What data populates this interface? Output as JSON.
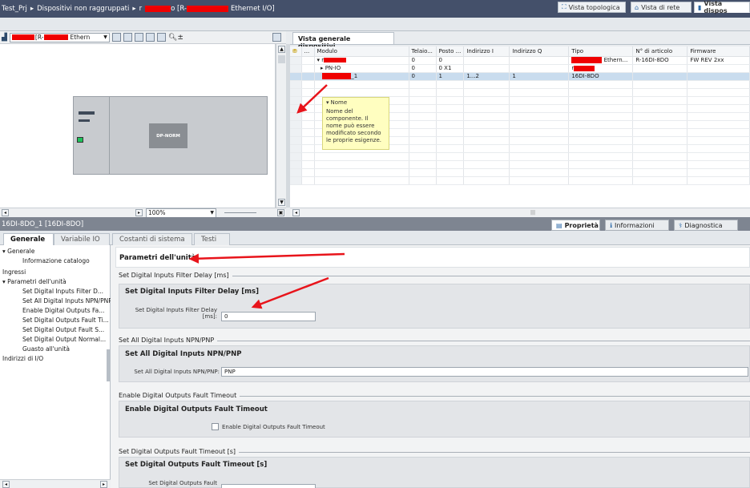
{
  "titlebar": {
    "project": "Test_Prj",
    "folder": "Dispositivi non raggruppati",
    "device_prefix": "r",
    "device_mid": "o [R-",
    "device_suffix": "Ethernet I/O]"
  },
  "view_tabs": {
    "topology": "Vista topologica",
    "network": "Vista di rete",
    "devices": "Vista dispos"
  },
  "toolbar": {
    "device_combo_mid": "[R-",
    "device_combo_suffix": "Ethern",
    "zoom": "100%"
  },
  "canvas": {
    "module_label": "DP-NORM"
  },
  "overview": {
    "tab_label": "Vista generale dispositivi",
    "columns": [
      "Modulo",
      "Telaio...",
      "Posto ...",
      "Indirizzo I",
      "Indirizzo Q",
      "Tipo",
      "N° di articolo",
      "Firmware"
    ],
    "rows": [
      {
        "module": "r",
        "rack": "0",
        "slot": "0",
        "addr_i": "",
        "addr_q": "",
        "type_suffix": "Ethern...",
        "article": "R-16DI-8DO",
        "firmware": "FW REV 2xx"
      },
      {
        "module": "PN-IO",
        "rack": "0",
        "slot": "0 X1",
        "addr_i": "",
        "addr_q": "",
        "type_suffix": "r",
        "article": "",
        "firmware": ""
      },
      {
        "module": "_1",
        "rack": "0",
        "slot": "1",
        "addr_i": "1...2",
        "addr_q": "1",
        "type_suffix": "16DI-8DO",
        "article": "",
        "firmware": ""
      }
    ]
  },
  "tooltip": {
    "title": "Nome",
    "text": "Nome del componente. Il nome può essere modificato secondo le proprie esigenze."
  },
  "inspector": {
    "title": "16DI-8DO_1 [16DI-8DO]",
    "tabs": {
      "properties": "Proprietà",
      "info": "Informazioni",
      "diagnostics": "Diagnostica"
    },
    "subtabs": [
      "Generale",
      "Variabile IO",
      "Costanti di sistema",
      "Testi"
    ]
  },
  "nav": {
    "items": [
      "Generale",
      "Informazione catalogo",
      "Ingressi",
      "Parametri dell'unità",
      "Set Digital Inputs Filter D...",
      "Set All Digital Inputs NPN/PNP",
      "Enable Digital Outputs Fa...",
      "Set Digital Outputs Fault Ti...",
      "Set Digital Output Fault S...",
      "Set Digital Output Normal...",
      "Guasto all'unità",
      "Indirizzi di I/O"
    ]
  },
  "content": {
    "page_title": "Parametri dell'unità",
    "sections": [
      {
        "header": "Set Digital Inputs Filter Delay [ms]",
        "title": "Set Digital Inputs Filter Delay [ms]",
        "label": "Set Digital Inputs Filter Delay [ms]:",
        "value": "0"
      },
      {
        "header": "Set All Digital Inputs NPN/PNP",
        "title": "Set All Digital Inputs NPN/PNP",
        "label": "Set All Digital Inputs NPN/PNP:",
        "value": "PNP"
      },
      {
        "header": "Enable Digital Outputs Fault Timeout",
        "title": "Enable Digital Outputs Fault Timeout",
        "label": "Enable Digital Outputs Fault Timeout",
        "value": ""
      },
      {
        "header": "Set Digital Outputs Fault Timeout [s]",
        "title": "Set Digital Outputs Fault Timeout [s]",
        "label": "Set Digital Outputs Fault",
        "value": ""
      }
    ]
  },
  "colors": {
    "redaction": "#ef0000",
    "annotation_arrow": "#e8141b",
    "titlebar": "#44506a",
    "selected_row": "#c9dcee",
    "tooltip_bg": "#fffec0"
  }
}
